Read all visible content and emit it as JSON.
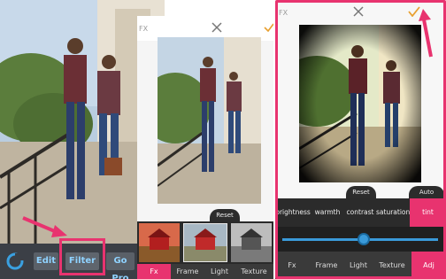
{
  "panel1": {
    "toolbar": {
      "edit_label": "Edit",
      "filter_label": "Filter",
      "gopro_label": "Go Pro"
    }
  },
  "panel2": {
    "top_label": "FX",
    "reset_label": "Reset",
    "tabs": [
      {
        "label": "Fx",
        "active": true
      },
      {
        "label": "Frame",
        "active": false
      },
      {
        "label": "Light",
        "active": false
      },
      {
        "label": "Texture",
        "active": false
      }
    ]
  },
  "panel3": {
    "top_label": "FX",
    "reset_label": "Reset",
    "auto_label": "Auto",
    "adjustments": [
      {
        "label": "brightness",
        "active": false
      },
      {
        "label": "warmth",
        "active": false
      },
      {
        "label": "contrast",
        "active": false
      },
      {
        "label": "saturation",
        "active": false
      },
      {
        "label": "tint",
        "active": true
      }
    ],
    "slider_value_fraction": 0.52,
    "tabs": [
      {
        "label": "Fx",
        "active": false
      },
      {
        "label": "Frame",
        "active": false
      },
      {
        "label": "Light",
        "active": false
      },
      {
        "label": "Texture",
        "active": false
      },
      {
        "label": "Adj",
        "active": true
      }
    ]
  },
  "colors": {
    "accent": "#e8336f",
    "slider": "#3a9ad9"
  },
  "icons": {
    "close": "close-icon",
    "confirm": "checkmark-icon",
    "logo": "app-logo-icon",
    "annotation_arrow": "pointer-arrow"
  }
}
